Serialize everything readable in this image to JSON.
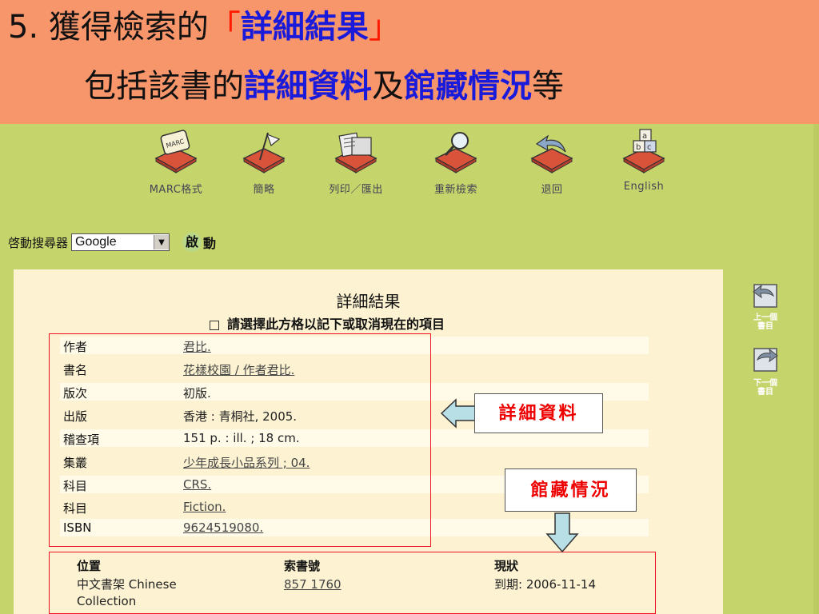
{
  "slide": {
    "number": "5.",
    "line1_pre": "獲得檢索的",
    "line1_open": "「",
    "line1_em": "詳細結果",
    "line1_close": "」",
    "line2_pre": "包括該書的",
    "line2_em1": "詳細資料",
    "line2_mid": "及",
    "line2_em2": "館藏情況",
    "line2_post": "等"
  },
  "toolbar": {
    "items": [
      {
        "label": "MARC格式",
        "icon": "marc-book-icon"
      },
      {
        "label": "簡略",
        "icon": "flag-book-icon"
      },
      {
        "label": "列印／匯出",
        "icon": "print-book-icon"
      },
      {
        "label": "重新檢索",
        "icon": "magnifier-book-icon"
      },
      {
        "label": "退回",
        "icon": "back-arrow-book-icon"
      },
      {
        "label": "English",
        "icon": "abc-blocks-book-icon"
      }
    ]
  },
  "search": {
    "label": "啓動搜尋器",
    "engine": "Google",
    "go_dot": "啟",
    "go_label": "動"
  },
  "results": {
    "title": "詳細結果",
    "select_prompt": "請選擇此方格以記下或取消現在的項目",
    "fields": [
      {
        "label": "作者",
        "value": "君比.",
        "link": true
      },
      {
        "label": "書名",
        "value": "花樣校園 / 作者君比.",
        "link": true
      },
      {
        "label": "版次",
        "value": "初版.",
        "link": false
      },
      {
        "label": "出版",
        "value": "香港 : 青桐社, 2005.",
        "link": false
      },
      {
        "label": "稽查項",
        "value": "151 p. : ill. ; 18 cm.",
        "link": false
      },
      {
        "label": "集叢",
        "value": "少年成長小品系列 ; 04.",
        "link": true
      },
      {
        "label": "科目",
        "value": "CRS.",
        "link": true
      },
      {
        "label": "科目",
        "value": "Fiction.",
        "link": true
      },
      {
        "label": "ISBN",
        "value": "9624519080.",
        "link": true
      }
    ]
  },
  "holdings": {
    "headers": {
      "location": "位置",
      "callno": "索書號",
      "status": "現狀"
    },
    "row": {
      "location_1": "中文書架 Chinese",
      "location_2": "Collection",
      "callno": "857 1760",
      "status": "到期: 2006-11-14"
    }
  },
  "callouts": {
    "details": "詳細資料",
    "holdings": "館藏情況"
  },
  "side_nav": {
    "prev_1": "上一個",
    "prev_2": "書目",
    "next_1": "下一個",
    "next_2": "書目"
  },
  "colors": {
    "header_bg": "#f7956b",
    "page_bg": "#c6d46c",
    "panel_bg": "#fdf3d2",
    "highlight_red": "#ff1a00",
    "highlight_blue": "#1a1adb",
    "book_red": "#d9533b",
    "arrow_fill": "#b9dfe6"
  }
}
